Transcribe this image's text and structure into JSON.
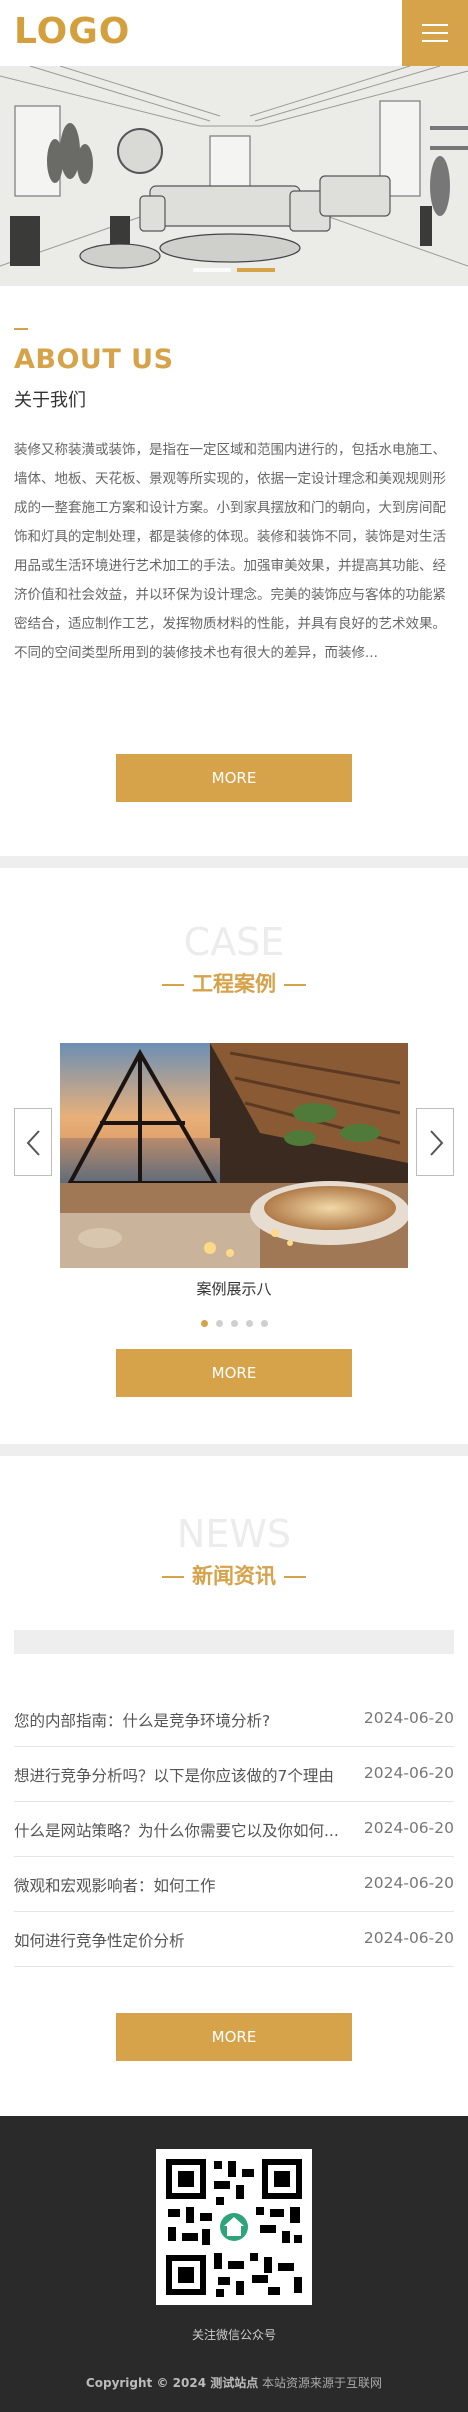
{
  "header": {
    "logo_text": "LOGO"
  },
  "banner": {
    "slide_count": 2,
    "active_index": 1
  },
  "about": {
    "heading": "ABOUT US",
    "subheading": "关于我们",
    "paragraph": "装修又称装潢或装饰，是指在一定区域和范围内进行的，包括水电施工、墙体、地板、天花板、景观等所实现的，依据一定设计理念和美观规则形成的一整套施工方案和设计方案。小到家具摆放和门的朝向，大到房间配饰和灯具的定制处理，都是装修的体现。装修和装饰不同，装饰是对生活用品或生活环境进行艺术加工的手法。加强审美效果，并提高其功能、经济价值和社会效益，并以环保为设计理念。完美的装饰应与客体的功能紧密结合，适应制作工艺，发挥物质材料的性能，并具有良好的艺术效果。不同的空间类型所用到的装修技术也有很大的差异，而装修...",
    "more_label": "MORE"
  },
  "case": {
    "title_en": "CASE",
    "title_cn": "工程案例",
    "caption": "案例展示八",
    "dot_count": 5,
    "active_dot": 0,
    "more_label": "MORE"
  },
  "news": {
    "title_en": "NEWS",
    "title_cn": "新闻资讯",
    "items": [
      {
        "title": "您的内部指南：什么是竞争环境分析?",
        "date": "2024-06-20"
      },
      {
        "title": "想进行竞争分析吗？以下是你应该做的7个理由",
        "date": "2024-06-20"
      },
      {
        "title": "什么是网站策略？为什么你需要它以及你如何...",
        "date": "2024-06-20"
      },
      {
        "title": "微观和宏观影响者：如何工作",
        "date": "2024-06-20"
      },
      {
        "title": "如何进行竞争性定价分析",
        "date": "2024-06-20"
      }
    ],
    "more_label": "MORE"
  },
  "footer": {
    "qr_label": "关注微信公众号",
    "copyright_prefix": "Copyright © 2024 测试站点",
    "copyright_suffix": "本站资源来源于互联网"
  },
  "colors": {
    "accent": "#d6a24a",
    "footer_bg": "#2a2a2a"
  }
}
